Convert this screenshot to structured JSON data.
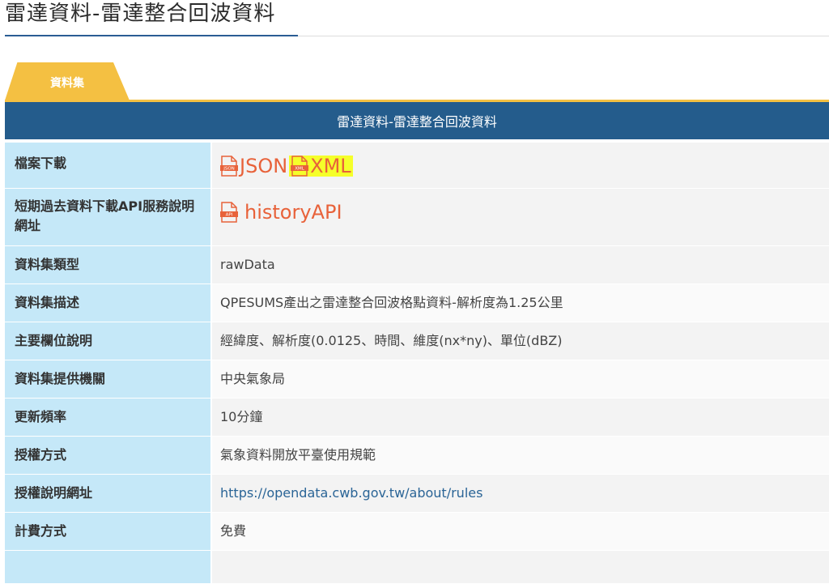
{
  "page": {
    "title": "雷達資料-雷達整合回波資料"
  },
  "tab": {
    "label": "資料集"
  },
  "table": {
    "header": "雷達資料-雷達整合回波資料",
    "rows": [
      {
        "label": "檔案下載"
      },
      {
        "label": "短期過去資料下載API服務說明網址"
      },
      {
        "label": "資料集類型",
        "value": "rawData"
      },
      {
        "label": "資料集描述",
        "value": "QPESUMS產出之雷達整合回波格點資料-解析度為1.25公里"
      },
      {
        "label": "主要欄位說明",
        "value": "經緯度、解析度(0.0125、時間、維度(nx*ny)、單位(dBZ)"
      },
      {
        "label": "資料集提供機關",
        "value": "中央氣象局"
      },
      {
        "label": "更新頻率",
        "value": "10分鐘"
      },
      {
        "label": "授權方式",
        "value": "氣象資料開放平臺使用規範"
      },
      {
        "label": "授權說明網址",
        "value": "https://opendata.cwb.gov.tw/about/rules"
      },
      {
        "label": "計費方式",
        "value": "免費"
      }
    ]
  },
  "downloads": {
    "json_label": "JSON",
    "json_icon_text": "JSON",
    "xml_label": "XML",
    "xml_icon_text": "XML",
    "api_label": "historyAPI",
    "api_icon_text": "API"
  },
  "colors": {
    "header_bg": "#245c8c",
    "tab_bg": "#f4c042",
    "label_bg": "#c5e8f8",
    "link_orange": "#e8623a",
    "highlight": "#f5ff2a"
  }
}
